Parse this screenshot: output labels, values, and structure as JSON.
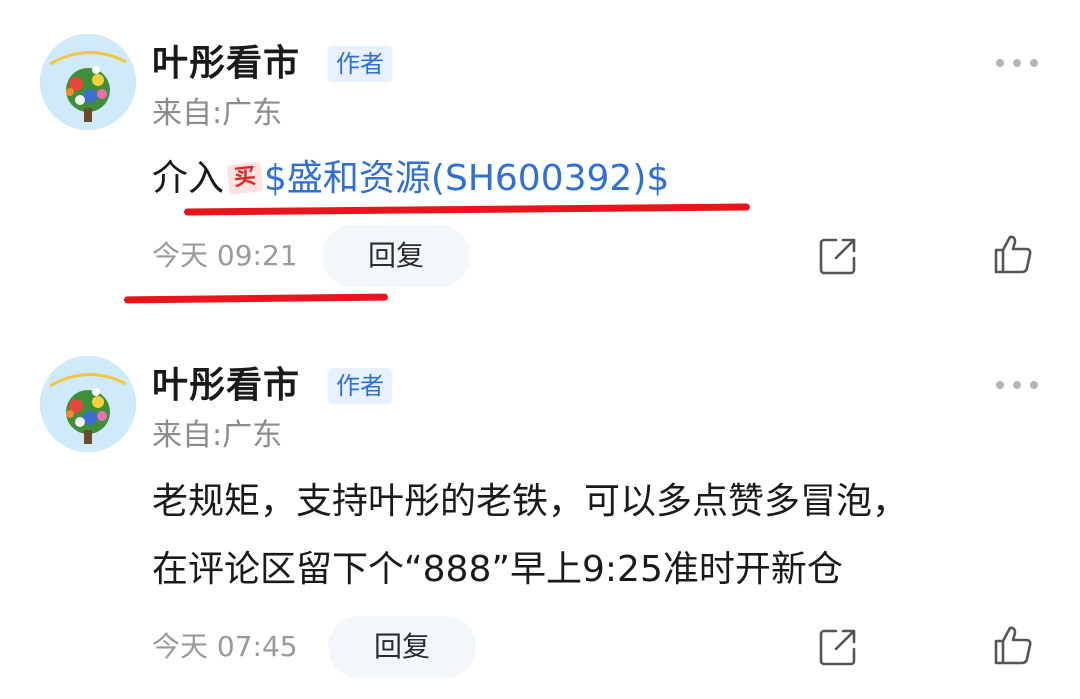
{
  "comments": [
    {
      "username": "叶彤看市",
      "badge": "作者",
      "location": "来自:广东",
      "text_prefix": "介入",
      "buy_tag": "买",
      "stock_link": "$盛和资源(SH600392)$",
      "timestamp": "今天 09:21",
      "reply_label": "回复"
    },
    {
      "username": "叶彤看市",
      "badge": "作者",
      "location": "来自:广东",
      "text_line1": "老规矩，支持叶彤的老铁，可以多点赞多冒泡，",
      "text_line2": "在评论区留下个“888”早上9:25准时开新仓",
      "timestamp": "今天 07:45",
      "reply_label": "回复"
    }
  ],
  "colors": {
    "link": "#2f6fd8",
    "badge_bg": "#e8f1fe",
    "annotation": "#e8151c",
    "muted": "#9a9a9a"
  },
  "icons": [
    "more-icon",
    "share-icon",
    "like-icon"
  ]
}
